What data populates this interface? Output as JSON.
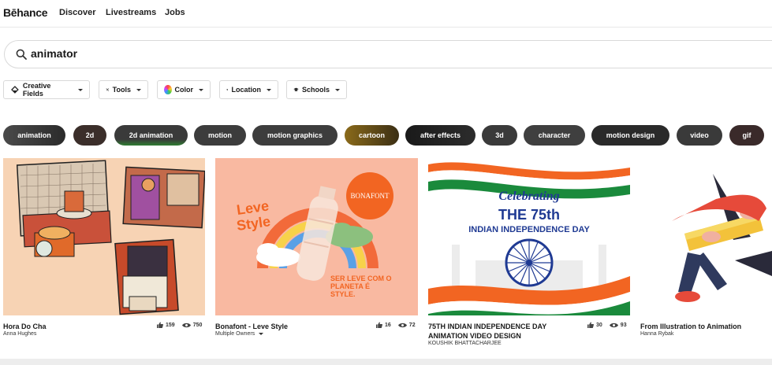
{
  "header": {
    "logo": "Bēhance",
    "nav": [
      "Discover",
      "Livestreams",
      "Jobs"
    ]
  },
  "search": {
    "value": "animator"
  },
  "filters": [
    "Creative Fields",
    "Tools",
    "Color",
    "Location",
    "Schools"
  ],
  "tags": [
    "animation",
    "2d",
    "2d animation",
    "motion",
    "motion graphics",
    "cartoon",
    "after effects",
    "3d",
    "character",
    "motion design",
    "video",
    "gif"
  ],
  "projects": [
    {
      "title": "Hora Do Cha",
      "owner": "Anna Hughes",
      "likes": "159",
      "views": "750"
    },
    {
      "title": "Bonafont - Leve Style",
      "owner": "Multiple Owners",
      "likes": "16",
      "views": "72",
      "image_text": {
        "brand": "BONAFONT",
        "slogan_1": "Leve",
        "slogan_2": "Style",
        "tagline": "SER LEVE COM O PLANETA É STYLE."
      }
    },
    {
      "title_line1": "75TH INDIAN INDEPENDENCE DAY",
      "title_line2": "ANIMATION VIDEO DESIGN",
      "owner": "KOUSHIK BHATTACHARJEE",
      "likes": "30",
      "views": "93",
      "image_text": {
        "line1": "Celebrating",
        "line2": "THE 75th",
        "line3": "INDIAN INDEPENDENCE DAY"
      }
    },
    {
      "title": "From Illustration to Animation",
      "owner": "Hanna Rybak"
    }
  ],
  "colors": {
    "peach_bg": "#f7d3b4",
    "salmon_bg": "#f9b9a1",
    "saffron": "#f26522",
    "green": "#1a8a3c",
    "navy": "#1f3a93"
  }
}
